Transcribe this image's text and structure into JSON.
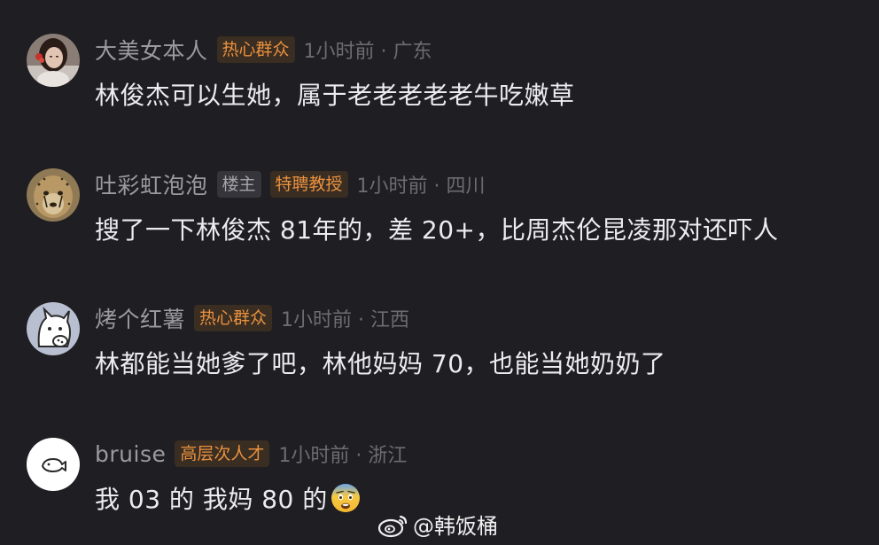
{
  "comments": [
    {
      "username": "大美女本人",
      "badges": [
        {
          "label": "热心群众",
          "style": "orange"
        }
      ],
      "time_location": "1小时前 · 广东",
      "text": "林俊杰可以生她，属于老老老老老牛吃嫩草",
      "avatar_icon": "woman-photo-avatar"
    },
    {
      "username": "吐彩虹泡泡",
      "badges": [
        {
          "label": "楼主",
          "style": "gray"
        },
        {
          "label": "特聘教授",
          "style": "orange"
        }
      ],
      "time_location": "1小时前 · 四川",
      "text": "搜了一下林俊杰 81年的，差 20+，比周杰伦昆凌那对还吓人",
      "avatar_icon": "cheetah-photo-avatar"
    },
    {
      "username": "烤个红薯",
      "badges": [
        {
          "label": "热心群众",
          "style": "orange"
        }
      ],
      "time_location": "1小时前 · 江西",
      "text": "林都能当她爹了吧，林他妈妈 70，也能当她奶奶了",
      "avatar_icon": "cartoon-cat-avatar"
    },
    {
      "username": "bruise",
      "badges": [
        {
          "label": "高层次人才",
          "style": "orange"
        }
      ],
      "time_location": "1小时前 · 浙江",
      "text": "我 03 的 我妈 80 的",
      "avatar_icon": "white-fish-avatar",
      "emoji": "fearful-face-emoji"
    }
  ],
  "watermark": {
    "text": "@韩饭桶",
    "icon": "weibo-logo-icon"
  },
  "colors": {
    "background": "#1f1e23",
    "badge_orange_text": "#e8913f",
    "badge_orange_bg": "#3a2d22",
    "badge_gray_text": "#a4a4a9",
    "username": "#9a9a9f",
    "meta": "#6c6c71",
    "text": "#ececee"
  }
}
